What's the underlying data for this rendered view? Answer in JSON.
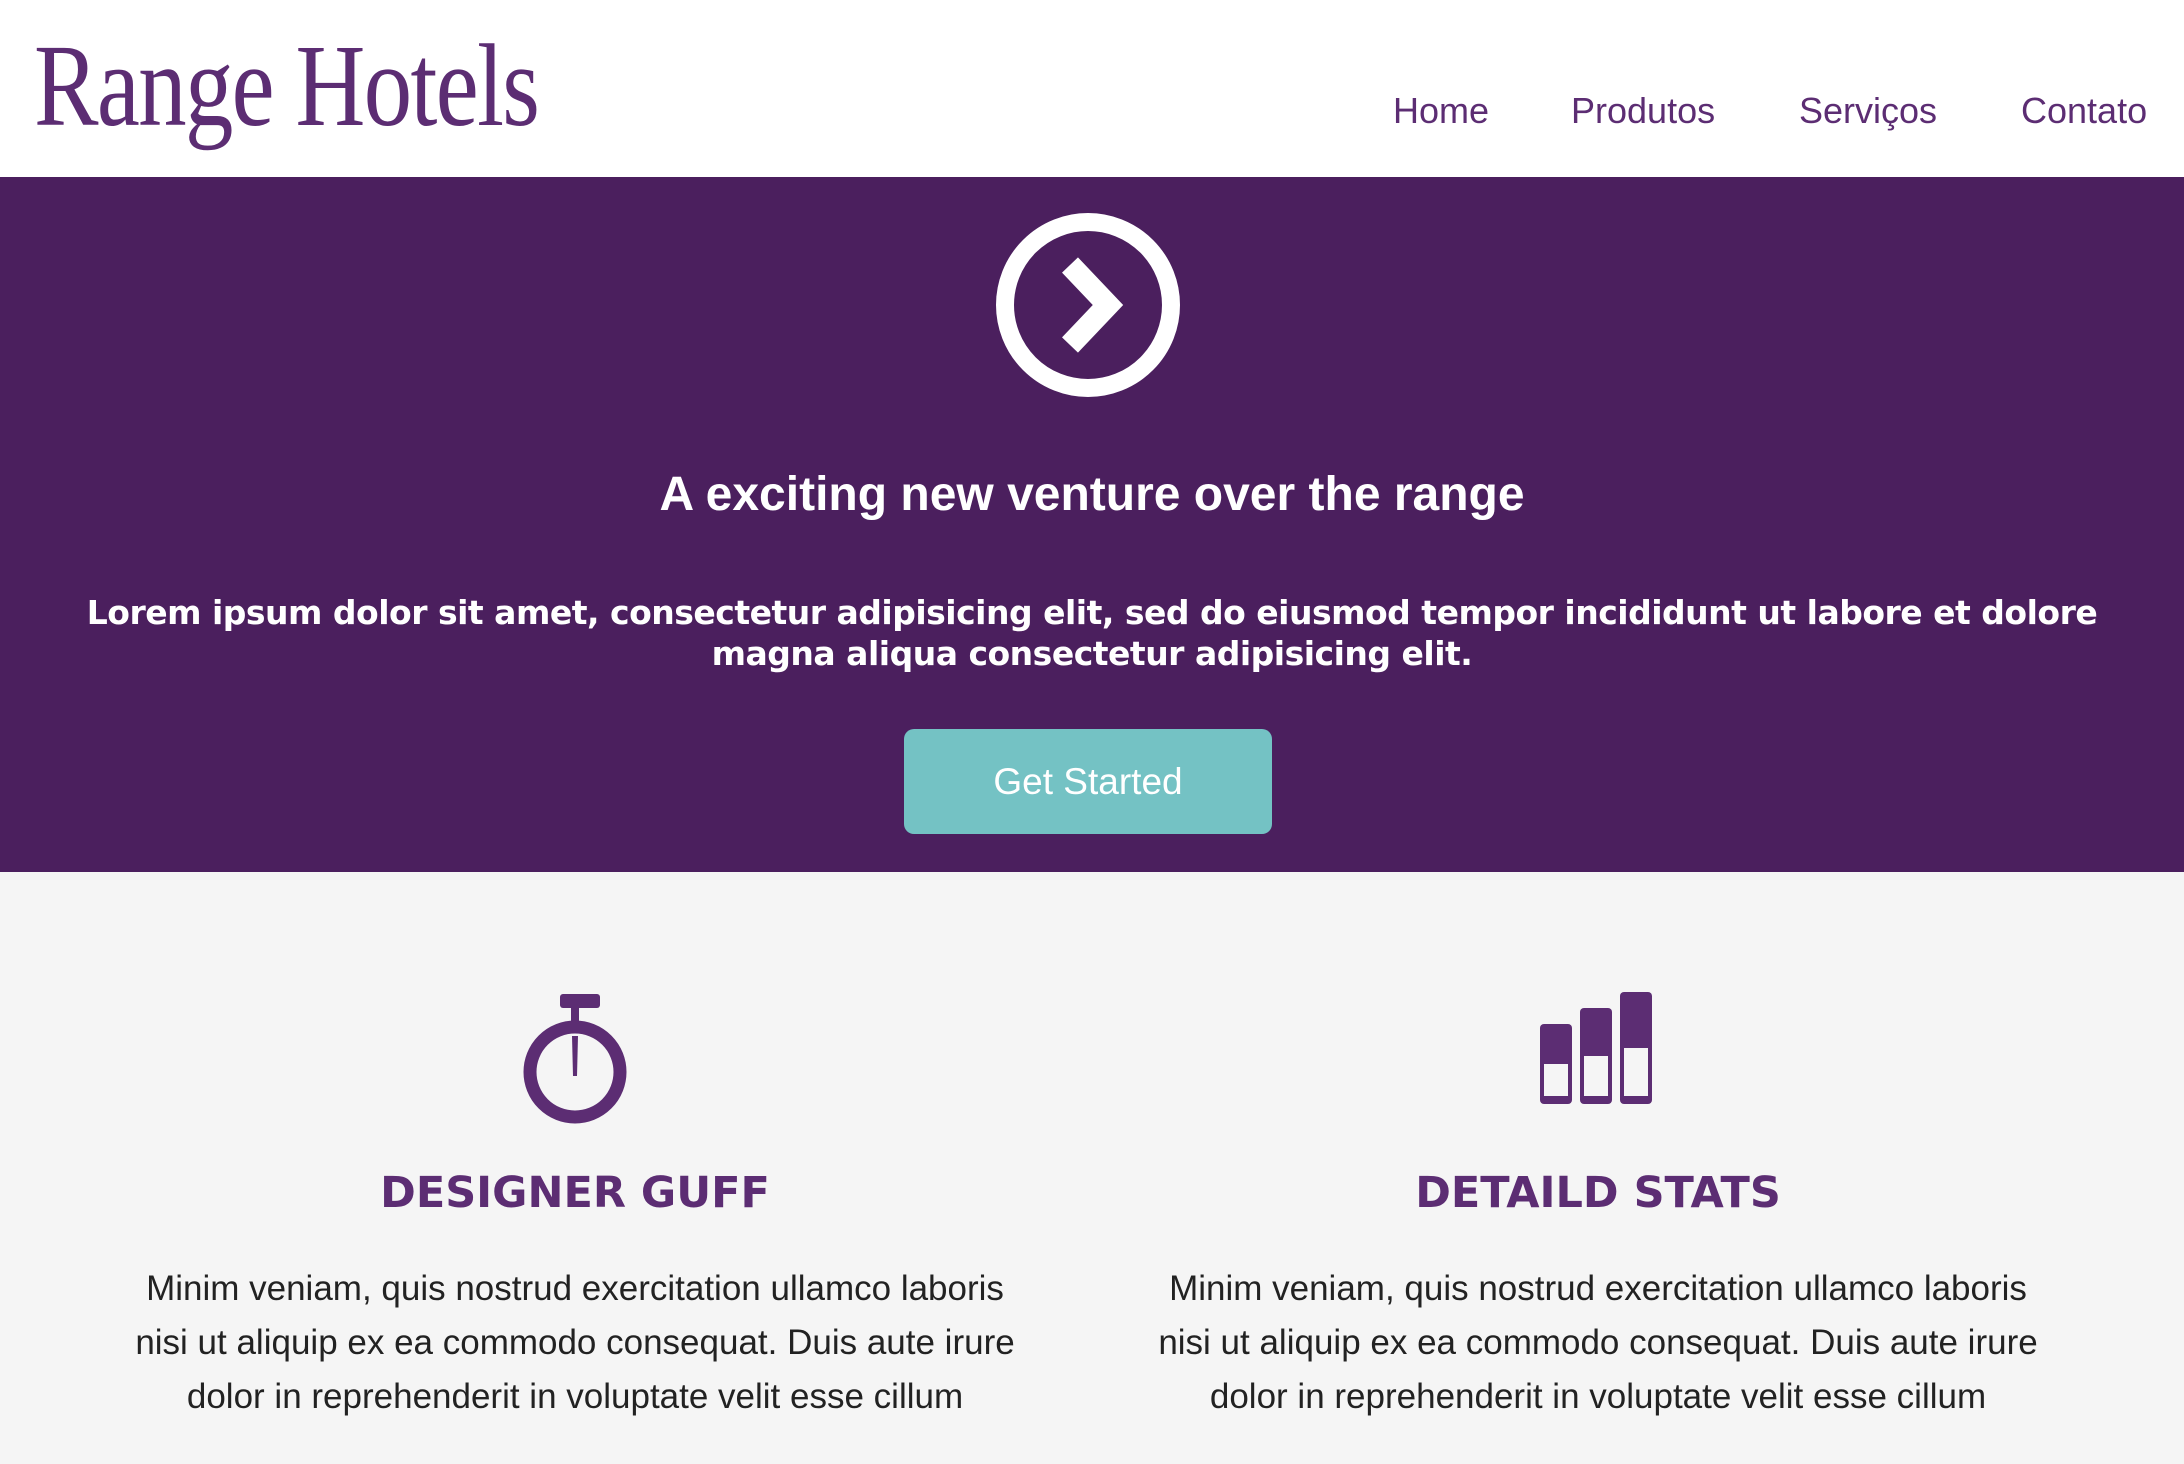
{
  "header": {
    "logo": "Range Hotels",
    "nav": [
      "Home",
      "Produtos",
      "Serviços",
      "Contato"
    ]
  },
  "hero": {
    "icon": "chevron-circle-right-icon",
    "title": "A exciting new venture over the range",
    "text": "Lorem ipsum dolor sit amet, consectetur adipisicing elit, sed do eiusmod tempor incididunt ut labore et dolore magna aliqua consectetur adipisicing elit.",
    "button": "Get Started"
  },
  "features": [
    {
      "icon": "stopwatch-icon",
      "title": "DESIGNER GUFF",
      "text": "Minim veniam, quis nostrud exercitation ullamco laboris nisi ut aliquip ex ea commodo consequat. Duis aute irure dolor in reprehenderit in voluptate velit esse cillum"
    },
    {
      "icon": "bar-stats-icon",
      "title": "DETAILD STATS",
      "text": "Minim veniam, quis nostrud exercitation ullamco laboris nisi ut aliquip ex ea commodo consequat. Duis aute irure dolor in reprehenderit in voluptate velit esse cillum"
    }
  ],
  "colors": {
    "brand": "#4b1f5e",
    "accent": "#74c2c4",
    "heading": "#5c2d73"
  }
}
